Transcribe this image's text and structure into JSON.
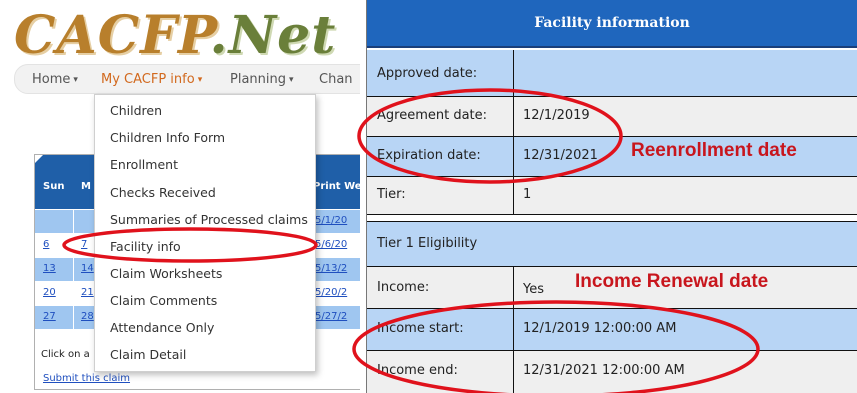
{
  "colors": {
    "header_blue": "#1f66bd",
    "row_blue": "#b8d5f5",
    "annotation_red": "#c8161d",
    "menu_active": "#d2691e"
  },
  "logo": {
    "text_a": "CACFP",
    "text_b": ".Net"
  },
  "navbar": {
    "home": "Home",
    "my_info": "My CACFP info",
    "planning": "Planning",
    "change": "Chan"
  },
  "dropdown": {
    "items": [
      "Children",
      "Children Info Form",
      "Enrollment",
      "Checks Received",
      "Summaries of Processed claims",
      "Facility info",
      "Claim Worksheets",
      "Claim Comments",
      "Attendance Only",
      "Claim Detail"
    ]
  },
  "calendar": {
    "headers": {
      "sun": "Sun",
      "mon": "M",
      "print": "Print We"
    },
    "rows": [
      {
        "sun": "",
        "mon": "",
        "print": "5/1/20"
      },
      {
        "sun": "6",
        "mon": "7",
        "print": "5/6/20"
      },
      {
        "sun": "13",
        "mon": "14",
        "print": "5/13/2"
      },
      {
        "sun": "20",
        "mon": "21",
        "print": "5/20/2"
      },
      {
        "sun": "27",
        "mon": "28",
        "print": "5/27/2"
      }
    ],
    "click_on": "Click on a",
    "submit": "Submit this claim"
  },
  "facility": {
    "title": "Facility information",
    "approved_label": "Approved date:",
    "approved_value": "",
    "agreement_label": "Agreement date:",
    "agreement_value": "12/1/2019",
    "expiration_label": "Expiration date:",
    "expiration_value": "12/31/2021",
    "tier_label": "Tier:",
    "tier_value": "1"
  },
  "eligibility": {
    "title": "Tier 1 Eligibility",
    "income_label": "Income:",
    "income_value": "Yes",
    "start_label": "Income start:",
    "start_value": "12/1/2019 12:00:00 AM",
    "end_label": "Income end:",
    "end_value": "12/31/2021 12:00:00 AM"
  },
  "annotations": {
    "reenrollment": "Reenrollment date",
    "income_renewal": "Income Renewal date"
  }
}
